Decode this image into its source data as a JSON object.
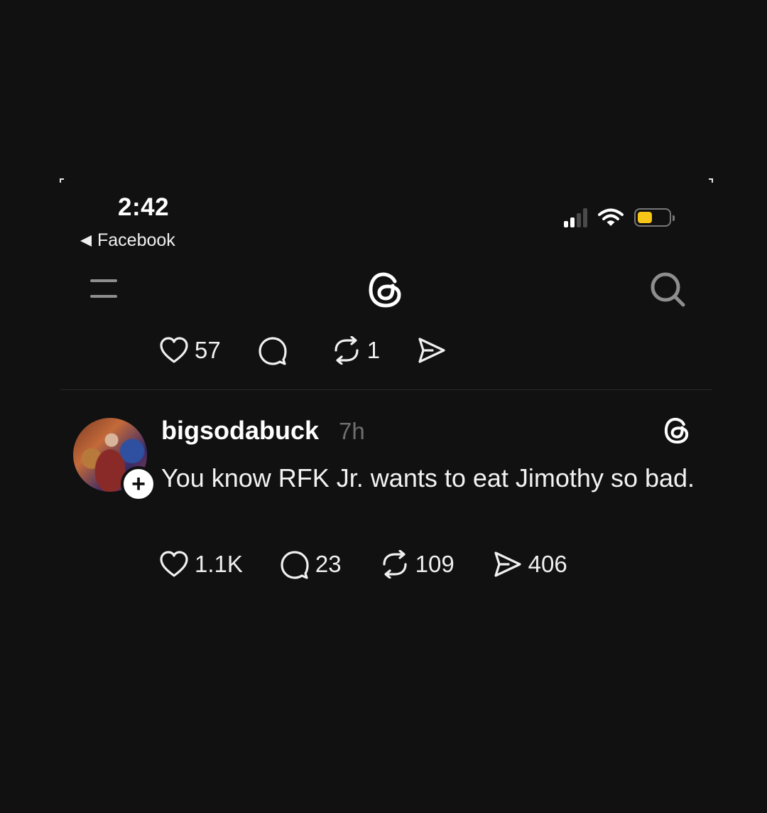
{
  "status_bar": {
    "time": "2:42",
    "back_label": "Facebook",
    "battery_color": "#f5c518"
  },
  "nav": {
    "menu_icon": "hamburger-icon",
    "logo_icon": "threads-logo-icon",
    "search_icon": "search-icon"
  },
  "previous_post": {
    "likes": "57",
    "replies": "",
    "reposts": "1",
    "shares": ""
  },
  "post": {
    "username": "bigsodabuck",
    "time": "7h",
    "text": "You know RFK Jr. wants to eat Jimothy so bad.",
    "follow_symbol": "+",
    "likes": "1.1K",
    "replies": "23",
    "reposts": "109",
    "shares": "406"
  }
}
